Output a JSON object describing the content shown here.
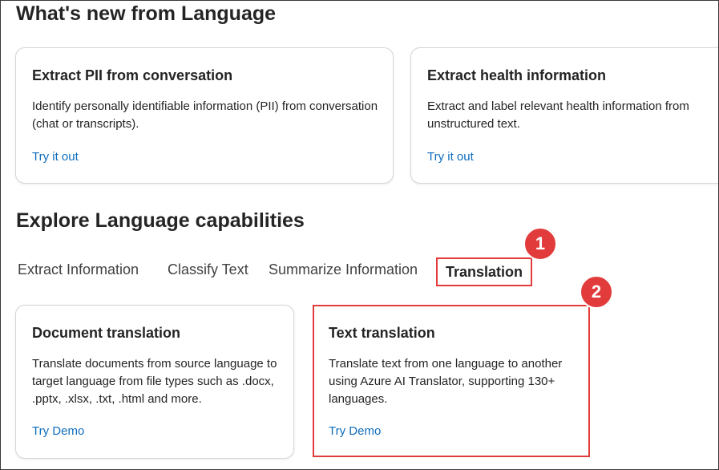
{
  "whats_new": {
    "heading": "What's new from Language",
    "cards": [
      {
        "title": "Extract PII from conversation",
        "description": "Identify personally identifiable information (PII) from conversation (chat or transcripts).",
        "link": "Try it out"
      },
      {
        "title": "Extract health information",
        "description": "Extract and label relevant health information from unstructured text.",
        "link": "Try it out"
      }
    ]
  },
  "explore": {
    "heading": "Explore Language capabilities",
    "tabs": [
      {
        "label": "Extract Information"
      },
      {
        "label": "Classify Text"
      },
      {
        "label": "Summarize Information"
      },
      {
        "label": "Translation",
        "selected": true
      }
    ],
    "cards": [
      {
        "title": "Document translation",
        "description": "Translate documents from source language to target language from file types such as .docx, .pptx, .xlsx, .txt, .html and more.",
        "link": "Try Demo"
      },
      {
        "title": "Text translation",
        "description": "Translate text from one language to another using Azure AI Translator, supporting 130+ languages.",
        "link": "Try Demo"
      }
    ]
  },
  "annotations": {
    "step_1": "1",
    "step_2": "2",
    "highlight_color": "#e23b3b"
  },
  "colors": {
    "link": "#0f6cbd",
    "text": "#242424"
  }
}
